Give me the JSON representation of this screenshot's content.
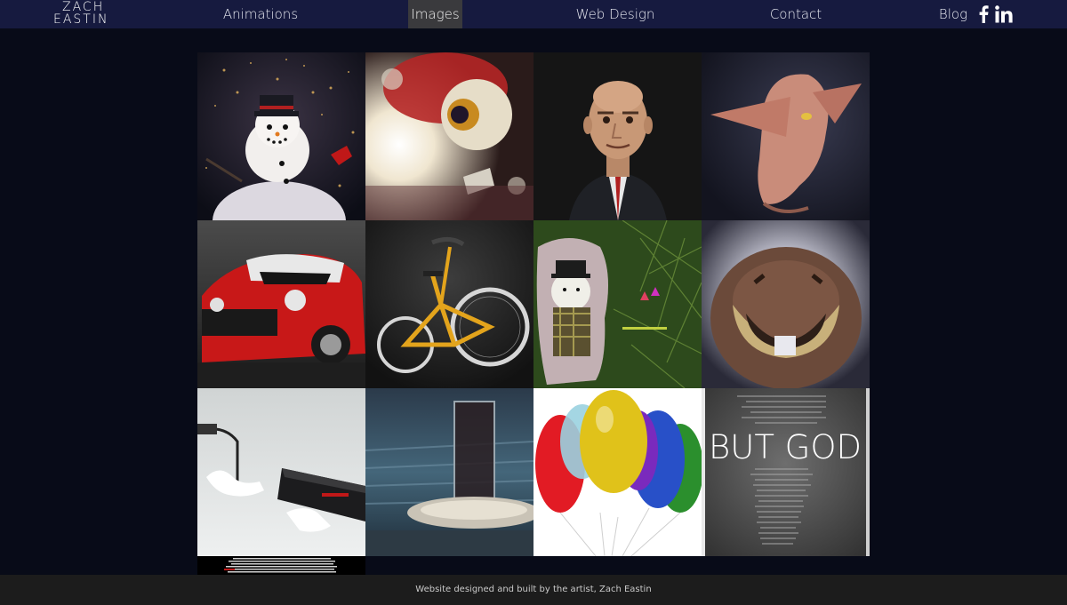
{
  "nav": {
    "logo_line1": "Zach",
    "logo_line2": "Eastin",
    "items": [
      {
        "label": "Animations"
      },
      {
        "label": "Images",
        "active": true
      },
      {
        "label": "Web Design"
      },
      {
        "label": "Contact"
      },
      {
        "label": "Blog"
      }
    ],
    "social": [
      "facebook-icon",
      "linkedin-icon"
    ]
  },
  "gallery": {
    "tiles": [
      {
        "subject": "snowman"
      },
      {
        "subject": "lightbulb-eyeball"
      },
      {
        "subject": "bald-man-portrait"
      },
      {
        "subject": "elf-sculpt"
      },
      {
        "subject": "red-mini-car"
      },
      {
        "subject": "yellow-bicycle"
      },
      {
        "subject": "snowman-ornament"
      },
      {
        "subject": "furry-creature"
      },
      {
        "subject": "charger-hands"
      },
      {
        "subject": "glass-on-table"
      },
      {
        "subject": "balloons"
      },
      {
        "subject": "but-god-poster",
        "caption": "BUT GOD"
      },
      {
        "subject": "text-document"
      }
    ]
  },
  "footer": {
    "text": "Website designed and built by the artist, Zach Eastin"
  },
  "colors": {
    "nav_bg": "#161a3f",
    "page_bg": "#080b18",
    "footer_bg": "#1c1c1c",
    "active_tab": "#3a3a3d"
  }
}
